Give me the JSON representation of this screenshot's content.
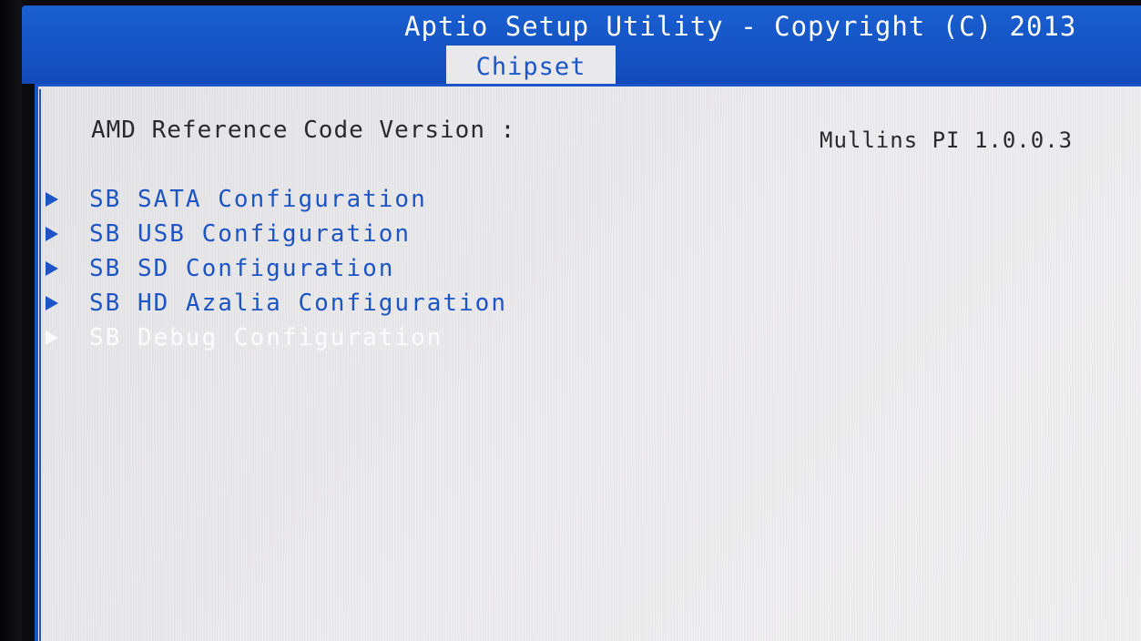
{
  "header": {
    "title": "Aptio Setup Utility - Copyright (C) 2013",
    "active_tab": "Chipset"
  },
  "info": {
    "label": "AMD Reference Code Version :",
    "value": "Mullins PI 1.0.0.3"
  },
  "menu": {
    "items": [
      {
        "label": "SB SATA Configuration"
      },
      {
        "label": "SB USB Configuration"
      },
      {
        "label": "SB SD Configuration"
      },
      {
        "label": "SB HD Azalia Configuration"
      },
      {
        "label": "SB Debug Configuration",
        "selected": true
      }
    ]
  },
  "colors": {
    "header_blue": "#1553c4",
    "panel_background": "#ebeaec",
    "link_blue": "#1d55c4",
    "selected_text": "#fafafa"
  },
  "icons": {
    "submenu": "submenu-arrow-icon"
  }
}
